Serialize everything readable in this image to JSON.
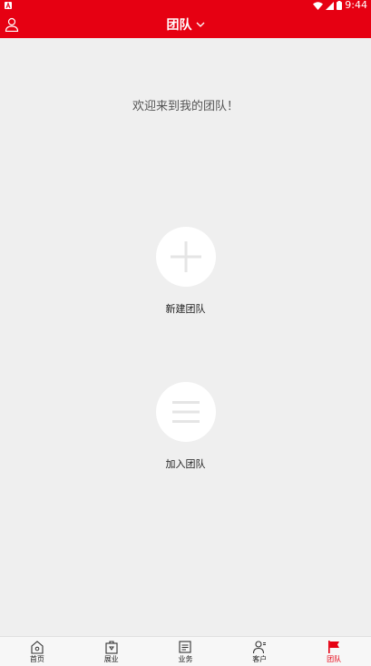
{
  "status_bar": {
    "time": "9:44"
  },
  "header": {
    "title": "团队"
  },
  "main": {
    "welcome": "欢迎来到我的团队！",
    "actions": [
      {
        "label": "新建团队",
        "icon": "plus-icon"
      },
      {
        "label": "加入团队",
        "icon": "list-icon"
      }
    ]
  },
  "bottom_nav": {
    "items": [
      {
        "label": "首页",
        "icon": "home-icon"
      },
      {
        "label": "展业",
        "icon": "briefcase-icon"
      },
      {
        "label": "业务",
        "icon": "document-icon"
      },
      {
        "label": "客户",
        "icon": "customer-icon"
      },
      {
        "label": "团队",
        "icon": "flag-icon",
        "active": true
      }
    ]
  },
  "colors": {
    "accent": "#e60012",
    "background": "#efefef",
    "icon_gray": "#e5e5e5"
  }
}
